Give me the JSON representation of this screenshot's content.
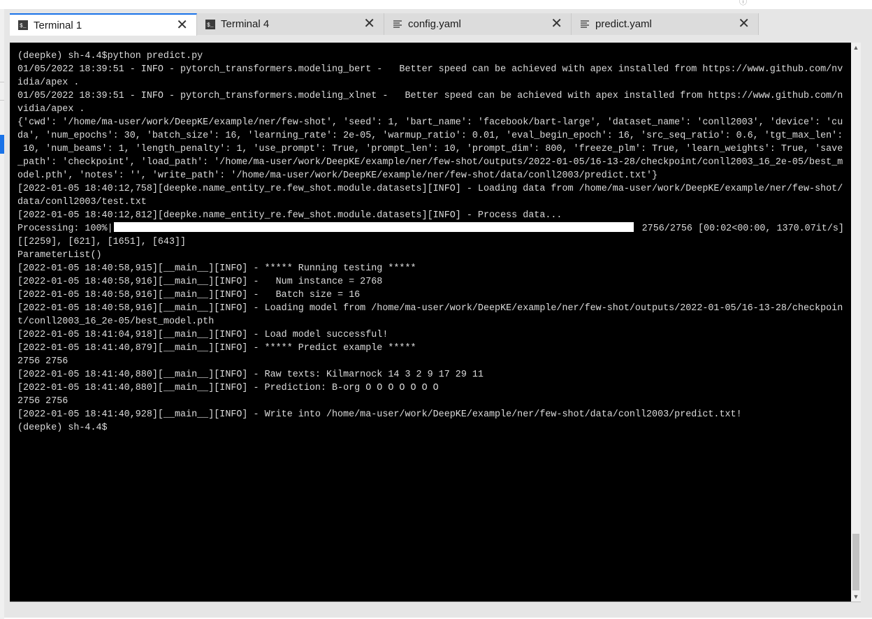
{
  "tabs": [
    {
      "label": "Terminal 1",
      "icon": "terminal-icon",
      "active": true
    },
    {
      "label": "Terminal 4",
      "icon": "terminal-icon",
      "active": false
    },
    {
      "label": "config.yaml",
      "icon": "text-file-icon",
      "active": false
    },
    {
      "label": "predict.yaml",
      "icon": "text-file-icon",
      "active": false
    }
  ],
  "close_glyph": "✕",
  "scrollbar": {
    "up": "▲",
    "down": "▼"
  },
  "terminal": {
    "lines": [
      "(deepke) sh-4.4$python predict.py",
      "01/05/2022 18:39:51 - INFO - pytorch_transformers.modeling_bert -   Better speed can be achieved with apex installed from https://www.github.com/nv",
      "idia/apex .",
      "01/05/2022 18:39:51 - INFO - pytorch_transformers.modeling_xlnet -   Better speed can be achieved with apex installed from https://www.github.com/n",
      "vidia/apex .",
      "{'cwd': '/home/ma-user/work/DeepKE/example/ner/few-shot', 'seed': 1, 'bart_name': 'facebook/bart-large', 'dataset_name': 'conll2003', 'device': 'cu",
      "da', 'num_epochs': 30, 'batch_size': 16, 'learning_rate': 2e-05, 'warmup_ratio': 0.01, 'eval_begin_epoch': 16, 'src_seq_ratio': 0.6, 'tgt_max_len':",
      " 10, 'num_beams': 1, 'length_penalty': 1, 'use_prompt': True, 'prompt_len': 10, 'prompt_dim': 800, 'freeze_plm': True, 'learn_weights': True, 'save",
      "_path': 'checkpoint', 'load_path': '/home/ma-user/work/DeepKE/example/ner/few-shot/outputs/2022-01-05/16-13-28/checkpoint/conll2003_16_2e-05/best_m",
      "odel.pth', 'notes': '', 'write_path': '/home/ma-user/work/DeepKE/example/ner/few-shot/data/conll2003/predict.txt'}",
      "[2022-01-05 18:40:12,758][deepke.name_entity_re.few_shot.module.datasets][INFO] - Loading data from /home/ma-user/work/DeepKE/example/ner/few-shot/",
      "data/conll2003/test.txt",
      "[2022-01-05 18:40:12,812][deepke.name_entity_re.few_shot.module.datasets][INFO] - Process data...",
      "__PROGRESS__",
      "[[2259], [621], [1651], [643]]",
      "ParameterList()",
      "[2022-01-05 18:40:58,915][__main__][INFO] - ***** Running testing *****",
      "[2022-01-05 18:40:58,916][__main__][INFO] -   Num instance = 2768",
      "[2022-01-05 18:40:58,916][__main__][INFO] -   Batch size = 16",
      "[2022-01-05 18:40:58,916][__main__][INFO] - Loading model from /home/ma-user/work/DeepKE/example/ner/few-shot/outputs/2022-01-05/16-13-28/checkpoin",
      "t/conll2003_16_2e-05/best_model.pth",
      "[2022-01-05 18:41:04,918][__main__][INFO] - Load model successful!",
      "[2022-01-05 18:41:40,879][__main__][INFO] - ***** Predict example *****",
      "2756 2756",
      "[2022-01-05 18:41:40,880][__main__][INFO] - Raw texts: Kilmarnock 14 3 2 9 17 29 11",
      "[2022-01-05 18:41:40,880][__main__][INFO] - Prediction: B-org O O O O O O O",
      "2756 2756",
      "[2022-01-05 18:41:40,928][__main__][INFO] - Write into /home/ma-user/work/DeepKE/example/ner/few-shot/data/conll2003/predict.txt!",
      "(deepke) sh-4.4$"
    ],
    "progress": {
      "prefix": "Processing: 100%|",
      "fraction": 1.0,
      "suffix": "| 2756/2756 [00:02<00:00, 1370.07it/s]"
    }
  }
}
